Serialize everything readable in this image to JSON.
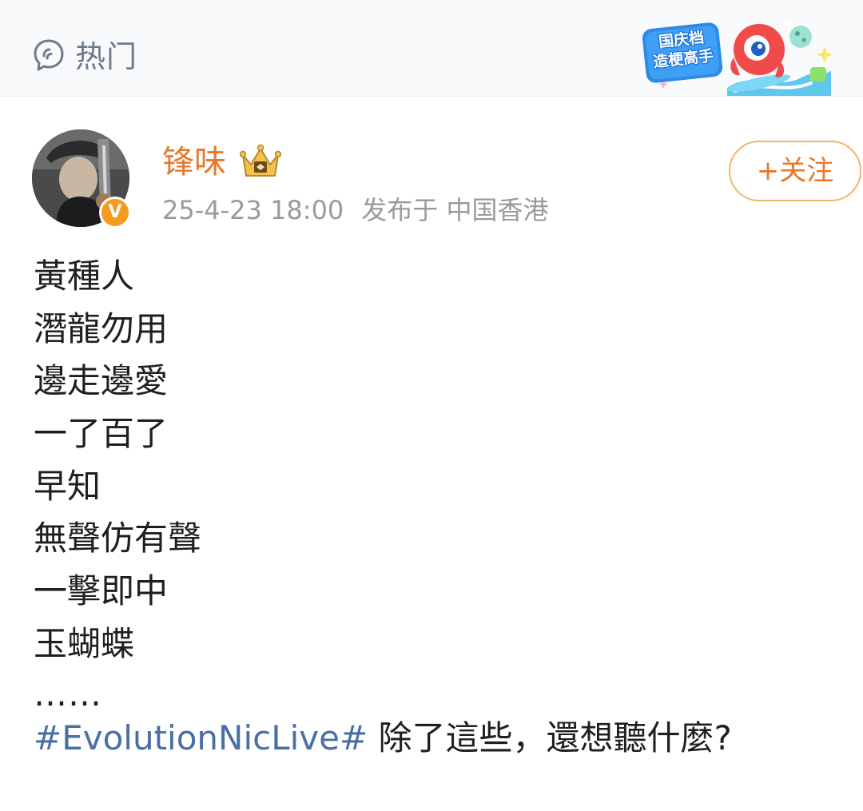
{
  "header": {
    "section_label": "热门",
    "badge_line1": "国庆档",
    "badge_line2": "造梗高手",
    "colors": {
      "header_text": "#6e7a8a",
      "badge_blue": "#1e6fd8"
    }
  },
  "post": {
    "username": "锋味",
    "date": "25-4-23 18:00",
    "location": "发布于 中国香港",
    "follow_label": "+关注",
    "verified_mark": "V",
    "lines": [
      "黃種人",
      "潛龍勿用",
      "邊走邊愛",
      "一了百了",
      "早知",
      "無聲仿有聲",
      "一擊即中",
      "玉蝴蝶"
    ],
    "ellipsis": "……",
    "hashtag": "#EvolutionNicLive#",
    "closing_text": " 除了這些，還想聽什麼?",
    "colors": {
      "username": "#e8782a",
      "hashtag": "#4a6fa5",
      "meta": "#9a9a9a",
      "body_text": "#1f1f1f"
    }
  }
}
